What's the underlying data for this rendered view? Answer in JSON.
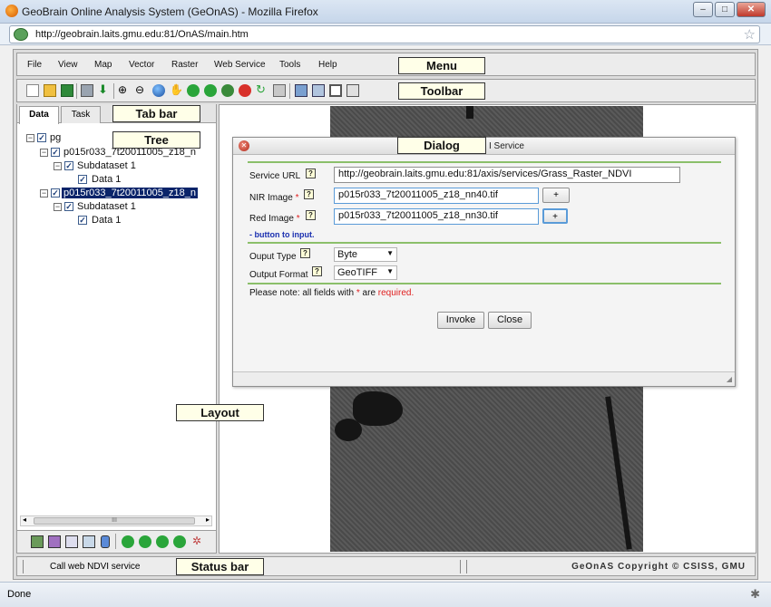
{
  "browser": {
    "title": "GeoBrain Online Analysis System (GeOnAS) - Mozilla Firefox",
    "url": "http://geobrain.laits.gmu.edu:81/OnAS/main.htm",
    "status": "Done"
  },
  "menu": {
    "items": [
      "File",
      "View",
      "Map",
      "Vector",
      "Raster",
      "Web Service",
      "Tools",
      "Help"
    ]
  },
  "tabs": {
    "data": "Data",
    "task": "Task"
  },
  "tree": {
    "root": "pg",
    "item1": "p015r033_7t20011005_z18_n",
    "item1_sub": "Subdataset 1",
    "item1_data": "Data 1",
    "item2": "p015r033_7t20011005_z18_n",
    "item2_sub": "Subdataset 1",
    "item2_data": "Data 1"
  },
  "dialog": {
    "title": "I Service",
    "service_url_label": "Service URL",
    "service_url_value": "http://geobrain.laits.gmu.edu:81/axis/services/Grass_Raster_NDVI",
    "nir_label": "NIR Image",
    "nir_value": "p015r033_7t20011005_z18_nn40.tif",
    "red_label": "Red Image",
    "red_value": "p015r033_7t20011005_z18_nn30.tif",
    "hint": "- button to input.",
    "output_type_label": "Ouput Type",
    "output_type_value": "Byte",
    "output_format_label": "Output Format",
    "output_format_value": "GeoTIFF",
    "note_prefix": "Please note: all fields with",
    "note_star": "*",
    "note_mid": "are",
    "note_required": "required.",
    "invoke": "Invoke",
    "close": "Close",
    "plus": "+",
    "help_glyph": "?"
  },
  "statusbar": {
    "message": "Call web NDVI service",
    "copyright": "GeOnAS Copyright © CSISS, GMU"
  },
  "callouts": {
    "menu": "Menu",
    "toolbar": "Toolbar",
    "tabbar": "Tab bar",
    "tree": "Tree",
    "dialog": "Dialog",
    "layout": "Layout",
    "statusbar": "Status bar"
  },
  "colors": {
    "required": "#e02020",
    "hint": "#1a2fb0",
    "selection": "#0a246a",
    "divider": "#8bbf6a"
  }
}
